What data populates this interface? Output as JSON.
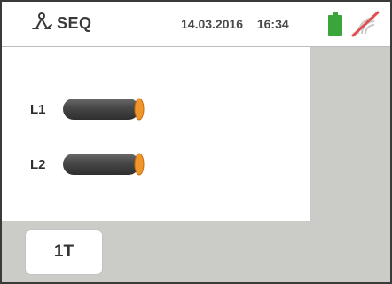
{
  "header": {
    "mode_icon": "phase-sequence-icon",
    "mode_label": "SEQ",
    "date": "14.03.2016",
    "time": "16:34",
    "battery_icon": "battery-icon",
    "battery_color": "#3aa53a",
    "wireless_icon": "wireless-disabled-icon",
    "wireless_slash_color": "#e05050"
  },
  "phases": [
    {
      "label": "L1",
      "icon": "cable-icon"
    },
    {
      "label": "L2",
      "icon": "cable-icon"
    }
  ],
  "buttons": {
    "mode_1t": "1T"
  },
  "colors": {
    "background": "#cbccc8",
    "panel": "#ffffff",
    "cable_body": "#4a4a4a",
    "cable_end": "#f0952a"
  }
}
